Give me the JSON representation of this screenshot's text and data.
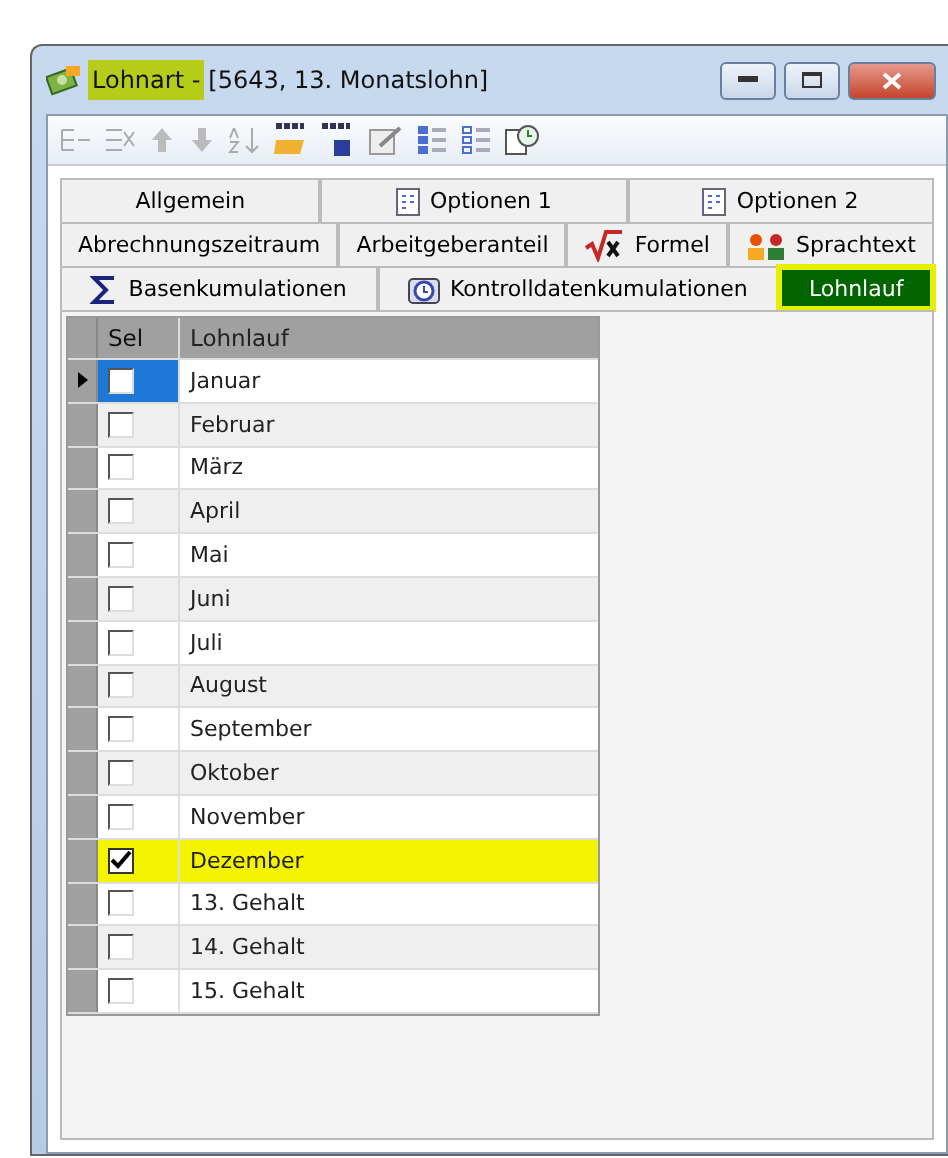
{
  "window": {
    "title_marked": "Lohnart -",
    "title_rest": "[5643, 13. Monatslohn]"
  },
  "tab_rows": [
    [
      {
        "label": "Allgemein",
        "selected": false,
        "highlighted": false
      },
      {
        "label": "Optionen 1",
        "selected": false,
        "highlighted": false
      },
      {
        "label": "Optionen 2",
        "selected": false,
        "highlighted": false
      }
    ],
    [
      {
        "label": "Abrechnungszeitraum",
        "selected": false,
        "highlighted": false
      },
      {
        "label": "Arbeitgeberanteil",
        "selected": false,
        "highlighted": false
      },
      {
        "label": "Formel",
        "selected": false,
        "highlighted": false
      },
      {
        "label": "Sprachtext",
        "selected": false,
        "highlighted": false
      }
    ],
    [
      {
        "label": "Basenkumulationen",
        "selected": false,
        "highlighted": false
      },
      {
        "label": "Kontrolldatenkumulationen",
        "selected": false,
        "highlighted": false
      },
      {
        "label": "Lohnlauf",
        "selected": true,
        "highlighted": true
      }
    ]
  ],
  "table": {
    "columns": [
      "Sel",
      "Lohnlauf"
    ],
    "rows": [
      {
        "name": "Januar",
        "checked": false,
        "current": true,
        "highlighted": false
      },
      {
        "name": "Februar",
        "checked": false,
        "current": false,
        "highlighted": false
      },
      {
        "name": "März",
        "checked": false,
        "current": false,
        "highlighted": false
      },
      {
        "name": "April",
        "checked": false,
        "current": false,
        "highlighted": false
      },
      {
        "name": "Mai",
        "checked": false,
        "current": false,
        "highlighted": false
      },
      {
        "name": "Juni",
        "checked": false,
        "current": false,
        "highlighted": false
      },
      {
        "name": "Juli",
        "checked": false,
        "current": false,
        "highlighted": false
      },
      {
        "name": "August",
        "checked": false,
        "current": false,
        "highlighted": false
      },
      {
        "name": "September",
        "checked": false,
        "current": false,
        "highlighted": false
      },
      {
        "name": "Oktober",
        "checked": false,
        "current": false,
        "highlighted": false
      },
      {
        "name": "November",
        "checked": false,
        "current": false,
        "highlighted": false
      },
      {
        "name": "Dezember",
        "checked": true,
        "current": false,
        "highlighted": true
      },
      {
        "name": "13. Gehalt",
        "checked": false,
        "current": false,
        "highlighted": false
      },
      {
        "name": "14. Gehalt",
        "checked": false,
        "current": false,
        "highlighted": false
      },
      {
        "name": "15. Gehalt",
        "checked": false,
        "current": false,
        "highlighted": false
      }
    ]
  }
}
